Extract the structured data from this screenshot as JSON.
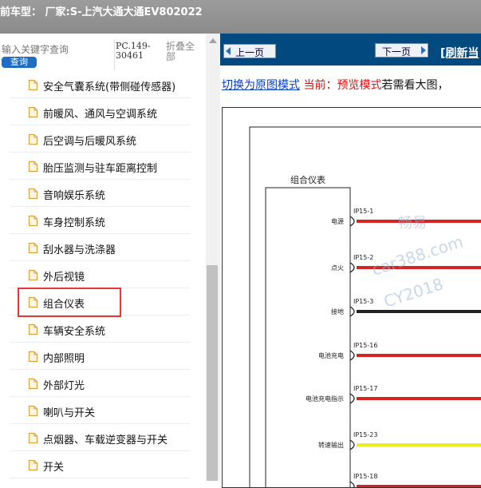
{
  "window": {
    "title": "前车型：  厂家:S-上汽大通大通EV802022"
  },
  "left_panel": {
    "search_placeholder": "输入关键字查询",
    "search_button": "查询",
    "pc_code": "PC.149-30461",
    "collapse_all": "折叠全部",
    "tree_items": [
      "安全气囊系统(带侧碰传感器)",
      "前暖风、通风与空调系统",
      "后空调与后暖风系统",
      "胎压监测与驻车距离控制",
      "音响娱乐系统",
      "车身控制系统",
      "刮水器与洗涤器",
      "外后视镜",
      "组合仪表",
      "车辆安全系统",
      "内部照明",
      "外部灯光",
      "喇叭与开关",
      "点烟器、车载逆变器与开关",
      "开关"
    ],
    "highlighted_index": 8
  },
  "right_panel": {
    "prev_label": "上一页",
    "next_label": "下一页",
    "refresh_label": "[刷新当",
    "mode_switch": "切换为原图模式",
    "mode_current": " 当前：预览模式",
    "mode_rest": "若需看大图，",
    "diagram": {
      "module_title": "组合仪表",
      "pins": [
        {
          "pin": "IP15-1",
          "label": "电源",
          "color": "#d42424"
        },
        {
          "pin": "IP15-2",
          "label": "点火",
          "color": "#d42424"
        },
        {
          "pin": "IP15-3",
          "label": "接地",
          "color": "#222222"
        },
        {
          "pin": "IP15-16",
          "label": "电池充电",
          "color": "#d42424"
        },
        {
          "pin": "IP15-17",
          "label": "电池充电指示",
          "color": "#d42424"
        },
        {
          "pin": "IP15-23",
          "label": "转速输出",
          "color": "#ecec1a"
        },
        {
          "pin": "IP15-18",
          "label": "",
          "color": "#d42424"
        }
      ],
      "watermarks": [
        "畅易",
        "car388.com",
        "CY2018"
      ]
    }
  },
  "colors": {
    "nav_blue": "#004a80",
    "highlight_red": "#e53935",
    "link_blue": "#0a3dbf"
  }
}
